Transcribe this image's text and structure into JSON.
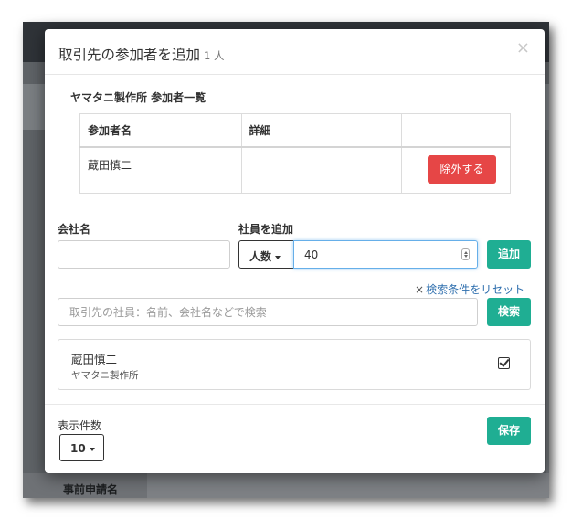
{
  "background": {
    "bottom_label": "事前申請名"
  },
  "modal": {
    "title": "取引先の参加者を追加",
    "count": "1 人",
    "close_icon": "close-icon",
    "participants": {
      "section_title": "ヤマタニ製作所 参加者一覧",
      "columns": [
        "参加者名",
        "詳細",
        ""
      ],
      "rows": [
        {
          "name": "蔵田慎二",
          "detail": "",
          "action_label": "除外する"
        }
      ]
    },
    "company": {
      "label": "会社名",
      "value": ""
    },
    "add_employee": {
      "label": "社員を追加",
      "mode": "人数",
      "value": "40",
      "add_label": "追加"
    },
    "reset_link": "検索条件をリセット",
    "search": {
      "placeholder": "取引先の社員：名前、会社名などで検索",
      "button_label": "検索"
    },
    "results": [
      {
        "name": "蔵田慎二",
        "company": "ヤマタニ製作所",
        "checked": true
      }
    ],
    "per_page": {
      "label": "表示件数",
      "value": "10"
    },
    "save_label": "保存"
  },
  "colors": {
    "teal": "#1fae93",
    "danger": "#e64646",
    "link": "#2f6fae"
  }
}
